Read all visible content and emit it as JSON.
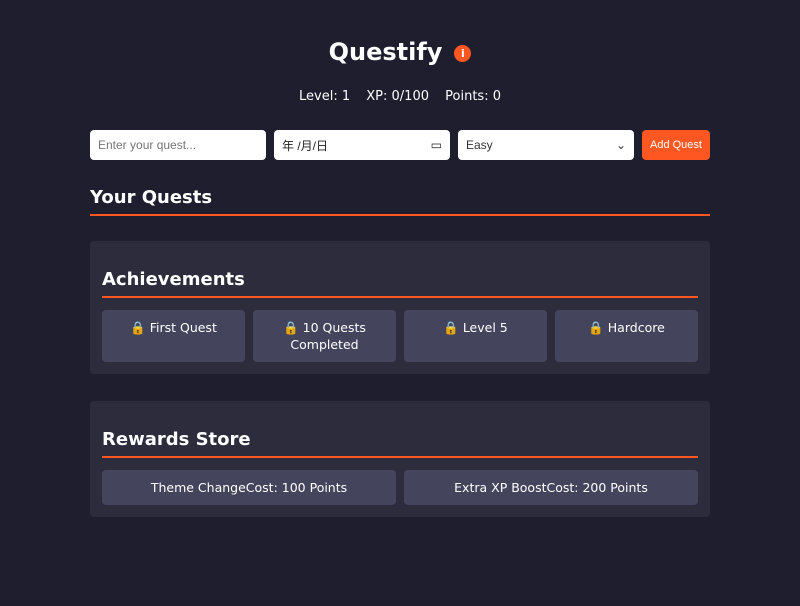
{
  "header": {
    "title": "Questify",
    "info_icon": "info-icon",
    "accent": "#ff5722"
  },
  "stats": {
    "level": "Level: 1",
    "xp": "XP: 0/100",
    "points": "Points: 0"
  },
  "form": {
    "quest_placeholder": "Enter your quest...",
    "date_value": "年 /月/日",
    "difficulty": "Easy",
    "add_label": "Add Quest"
  },
  "quests": {
    "title": "Your Quests"
  },
  "achievements": {
    "title": "Achievements",
    "items": [
      {
        "label": "First Quest"
      },
      {
        "label": "10 Quests Completed"
      },
      {
        "label": "Level 5"
      },
      {
        "label": "Hardcore"
      }
    ]
  },
  "rewards": {
    "title": "Rewards Store",
    "items": [
      {
        "label": "Theme ChangeCost: 100 Points"
      },
      {
        "label": "Extra XP BoostCost: 200 Points"
      }
    ]
  }
}
